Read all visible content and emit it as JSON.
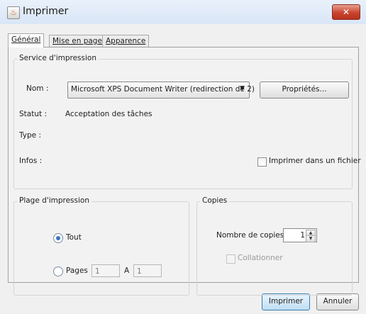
{
  "window": {
    "title": "Imprimer",
    "close_symbol": "✕"
  },
  "tabs": [
    {
      "label": "Général"
    },
    {
      "label": "Mise en page"
    },
    {
      "label": "Apparence"
    }
  ],
  "print_service": {
    "legend": "Service d'impression",
    "name_label": "Nom :",
    "printer_value": "Microsoft XPS Document Writer (redirection de 2)",
    "dropdown_arrow": "▼",
    "properties_button": "Propriétés...",
    "status_label": "Statut :",
    "status_value": "Acceptation des tâches",
    "type_label": "Type :",
    "info_label": "Infos :",
    "print_to_file_label": "Imprimer dans un fichier",
    "print_to_file_checked": false
  },
  "print_range": {
    "legend": "Plage d'impression",
    "all_label": "Tout",
    "pages_label": "Pages",
    "from_value": "1",
    "to_label": "A",
    "to_value": "1",
    "selected": "all"
  },
  "copies": {
    "legend": "Copies",
    "count_label": "Nombre de copies :",
    "count_value": "1",
    "collate_label": "Collationner",
    "collate_checked": false,
    "collate_enabled": false
  },
  "footer": {
    "print_button": "Imprimer",
    "cancel_button": "Annuler"
  }
}
